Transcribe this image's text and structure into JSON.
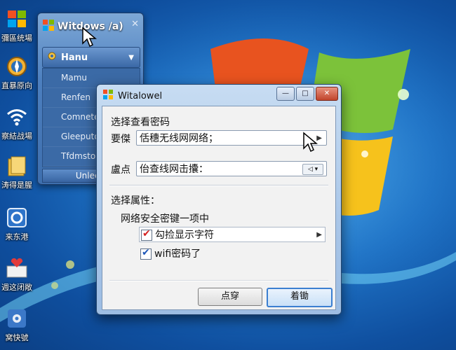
{
  "desktop": {
    "icons": [
      {
        "label": "彌區统場",
        "icon": "computer-icon"
      },
      {
        "label": "直暴原向",
        "icon": "network-icon"
      },
      {
        "label": "察結战場",
        "icon": "wifi-icon"
      },
      {
        "label": "涛得是腥",
        "icon": "folder-icon"
      },
      {
        "label": "来东港",
        "icon": "settings-icon"
      },
      {
        "label": "週这闭敞",
        "icon": "help-icon"
      },
      {
        "label": "窝快號",
        "icon": "security-icon"
      }
    ]
  },
  "back_window": {
    "title": "Witdows /a)",
    "dropdown": "Hanu",
    "menu_items": [
      "Mamu",
      "Renfen",
      "Comnete",
      "Gleeputor",
      "Tfdmstor"
    ],
    "footer": "Unleew"
  },
  "dialog": {
    "title": "Witalowel",
    "section_title": "选择查看密码",
    "row1": {
      "label": "要傑",
      "value": "佸穗无线网网络；"
    },
    "row2": {
      "label": "盧点",
      "value": "佁查线网击攮："
    },
    "properties_title": "选择属性：",
    "properties_subtitle": "网络安全密键一项中",
    "option1": {
      "label": "勾捡显示字符",
      "checked": true,
      "check_color": "#d42020"
    },
    "option2": {
      "label": "wifi密码了",
      "checked": true,
      "check_color": "#1e57b8"
    },
    "buttons": {
      "secondary": "点穿",
      "primary": "着锄"
    }
  },
  "colors": {
    "accent": "#3b7fd1",
    "desktop_bg": "#1f73c6"
  }
}
